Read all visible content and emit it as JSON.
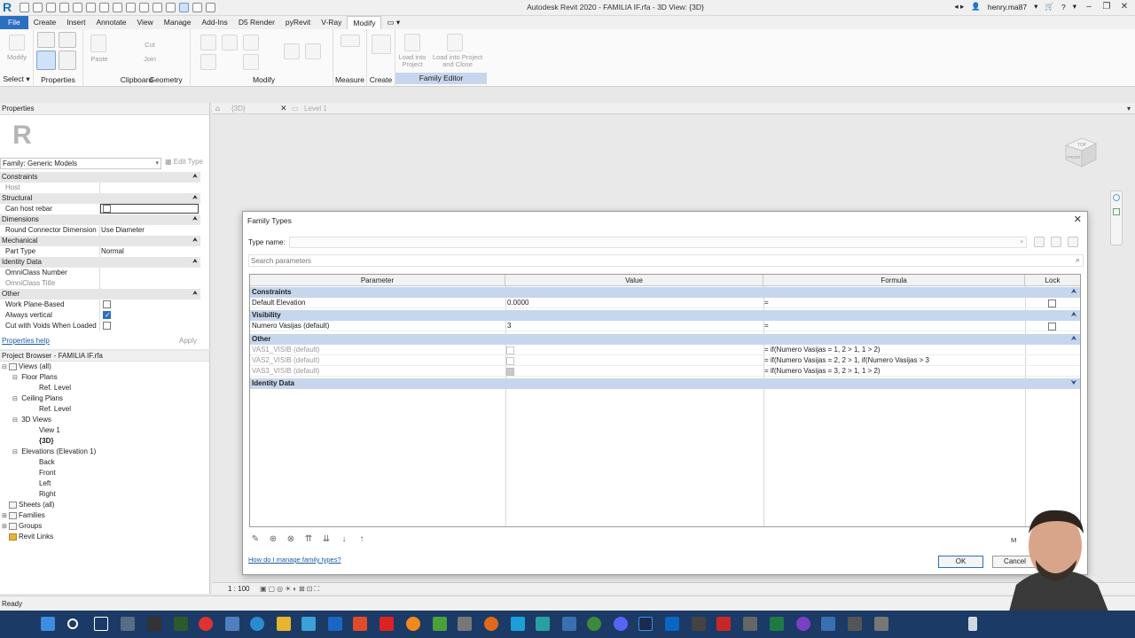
{
  "window": {
    "title": "Autodesk Revit 2020 - FAMILIA IF.rfa - 3D View: {3D}",
    "user": "henry.ma87"
  },
  "ribbon": {
    "tabs": [
      "File",
      "Create",
      "Insert",
      "Annotate",
      "View",
      "Manage",
      "Add-Ins",
      "D5 Render",
      "pyRevit",
      "V-Ray",
      "Modify"
    ],
    "active_tab": "Modify",
    "groups": {
      "select": "Select",
      "properties": "Properties",
      "clipboard": "Clipboard",
      "geometry": "Geometry",
      "modify": "Modify",
      "measure": "Measure",
      "create": "Create",
      "family_editor": "Family Editor"
    },
    "labels": {
      "modify_btn": "Modify",
      "paste": "Paste",
      "cut": "Cut",
      "join": "Join",
      "load_project": "Load into Project",
      "load_project_close": "Load into Project and Close"
    }
  },
  "properties": {
    "title": "Properties",
    "family_selector": "Family: Generic Models",
    "edit_type": "Edit Type",
    "categories": {
      "constraints": "Constraints",
      "structural": "Structural",
      "dimensions": "Dimensions",
      "mechanical": "Mechanical",
      "identity": "Identity Data",
      "other": "Other"
    },
    "rows": {
      "host": "Host",
      "can_host_rebar": "Can host rebar",
      "round_connector": "Round Connector Dimension",
      "round_connector_val": "Use Diameter",
      "part_type": "Part Type",
      "part_type_val": "Normal",
      "omniclass_number": "OmniClass Number",
      "omniclass_title": "OmniClass Title",
      "work_plane": "Work Plane-Based",
      "always_vertical": "Always vertical",
      "cut_voids": "Cut with Voids When Loaded"
    },
    "help_link": "Properties help",
    "apply": "Apply"
  },
  "browser": {
    "title": "Project Browser - FAMILIA IF.rfa",
    "nodes": {
      "views_all": "Views (all)",
      "floor_plans": "Floor Plans",
      "fp_ref_level": "Ref. Level",
      "ceiling_plans": "Ceiling Plans",
      "cp_ref_level": "Ref. Level",
      "views_3d": "3D Views",
      "view1": "View 1",
      "view3d": "{3D}",
      "elevations": "Elevations (Elevation 1)",
      "back": "Back",
      "front": "Front",
      "left": "Left",
      "right": "Right",
      "sheets": "Sheets (all)",
      "families": "Families",
      "groups": "Groups",
      "revit_links": "Revit Links"
    }
  },
  "view_tabs": {
    "tab1": "{3D}",
    "tab2": "Level 1"
  },
  "viewcube": {
    "top": "TOP",
    "front": "FRONT"
  },
  "view_bar": {
    "scale": "1 : 100"
  },
  "status": "Ready",
  "dialog": {
    "title": "Family Types",
    "type_name_label": "Type name:",
    "search_placeholder": "Search parameters",
    "columns": [
      "Parameter",
      "Value",
      "Formula",
      "Lock"
    ],
    "groups": {
      "constraints": "Constraints",
      "visibility": "Visibility",
      "other": "Other",
      "identity": "Identity Data"
    },
    "rows": {
      "default_elevation": {
        "param": "Default Elevation",
        "value": "0.0000",
        "formula": "="
      },
      "numero_vasijas": {
        "param": "Numero Vasijas (default)",
        "value": "3",
        "formula": "="
      },
      "vas1": {
        "param": "VAS1_VISIB (default)",
        "formula": "= if(Numero Vasijas = 1, 2 > 1, 1 > 2)"
      },
      "vas2": {
        "param": "VAS2_VISIB (default)",
        "formula": "= if(Numero Vasijas = 2, 2 > 1, if(Numero Vasijas > 3"
      },
      "vas3": {
        "param": "VAS3_VISIB (default)",
        "formula": "= if(Numero Vasijas = 3, 2 > 1, 1 > 2)"
      }
    },
    "help_link": "How do I manage family types?",
    "manage_label": "M",
    "ok": "OK",
    "cancel": "Cancel"
  }
}
